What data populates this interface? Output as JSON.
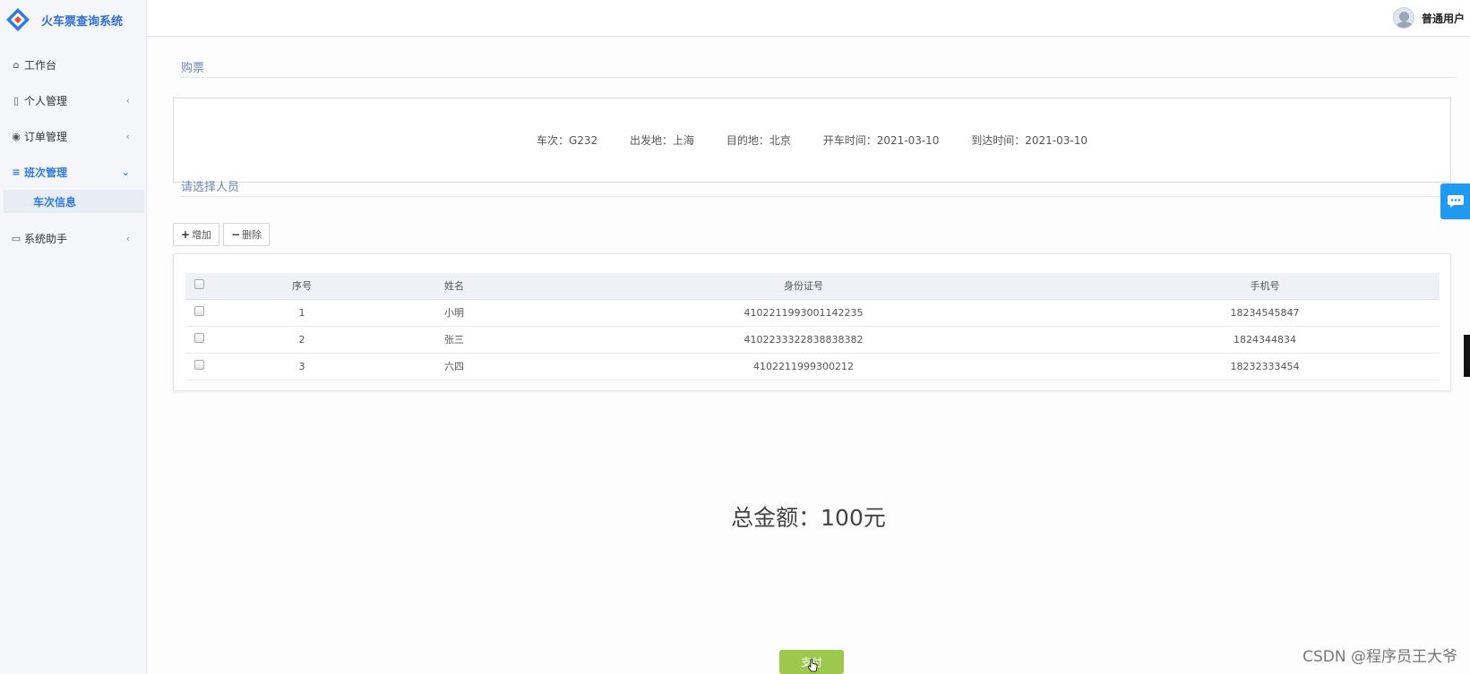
{
  "app": {
    "title": "火车票查询系统",
    "logo_icon": "diamond-logo-icon",
    "brand_color": "#2d6fd6"
  },
  "sidebar": {
    "items": [
      {
        "label": "工作台",
        "icon": "home-icon"
      },
      {
        "label": "个人管理",
        "icon": "id-card-icon",
        "chevron": "‹"
      },
      {
        "label": "订单管理",
        "icon": "location-pin-icon",
        "chevron": "‹"
      },
      {
        "label": "班次管理",
        "icon": "list-icon",
        "chevron": "⌄",
        "active": true
      },
      {
        "label": "系统助手",
        "icon": "laptop-icon",
        "chevron": "‹"
      }
    ],
    "sub_items": [
      {
        "label": "车次信息",
        "active": true
      }
    ]
  },
  "header": {
    "user_name": "普通用户"
  },
  "purchase": {
    "section_title": "购票",
    "trip": {
      "train": "车次：G232",
      "origin": "出发地：上海",
      "destination": "目的地：北京",
      "depart_time": "开车时间：2021-03-10",
      "arrive_time": "到达时间：2021-03-10"
    }
  },
  "passengers": {
    "section_title": "请选择人员",
    "add_label": "增加",
    "delete_label": "删除",
    "columns": [
      "序号",
      "姓名",
      "身份证号",
      "手机号"
    ],
    "rows": [
      {
        "no": "1",
        "name": "小明",
        "id_card": "410221199300114223​5",
        "phone": "18234545847"
      },
      {
        "no": "2",
        "name": "张三",
        "id_card": "4102233322838838382",
        "phone": "1824344834"
      },
      {
        "no": "3",
        "name": "六四",
        "id_card": "4102211999300212",
        "phone": "18232333454"
      }
    ]
  },
  "total": {
    "text": "总金额：100元"
  },
  "pay": {
    "label": "支付",
    "color": "#9cc94d"
  },
  "watermark": "CSDN @程序员王大爷",
  "colors": {
    "accent": "#2d7be5",
    "chat_float": "#1e9bf0"
  }
}
